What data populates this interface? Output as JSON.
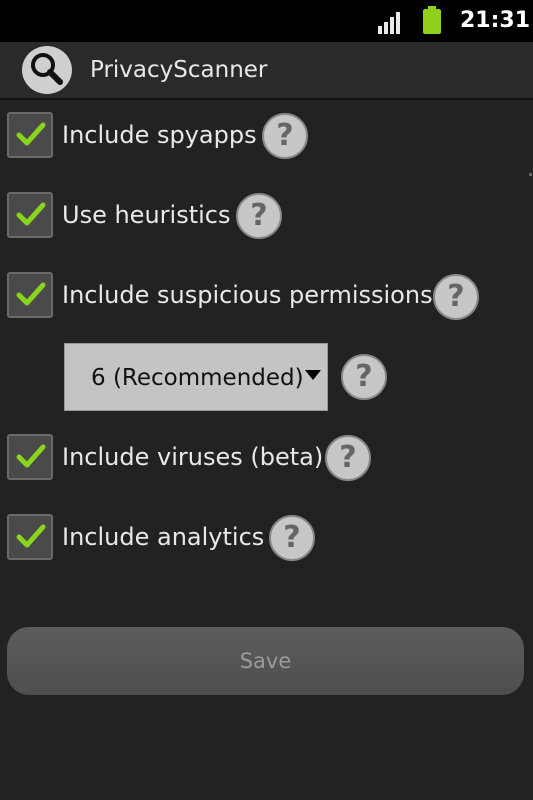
{
  "status_bar": {
    "time": "21:31",
    "signal_icon": "signal-icon",
    "battery_icon": "battery-icon",
    "battery_color": "#8fd11a"
  },
  "title_bar": {
    "app_title": "PrivacyScanner",
    "app_icon": "magnifier-icon"
  },
  "options": [
    {
      "label": "Include spyapps",
      "checked": true
    },
    {
      "label": "Use heuristics",
      "checked": true
    },
    {
      "label": "Include suspicious permissions",
      "checked": true
    },
    {
      "label": "Include viruses (beta)",
      "checked": true
    },
    {
      "label": "Include analytics",
      "checked": true
    }
  ],
  "spinner": {
    "selected": "6 (Recommended)"
  },
  "help_glyph": "?",
  "save_button": {
    "label": "Save",
    "enabled": false
  },
  "colors": {
    "check": "#8ad61e",
    "background": "#222222"
  }
}
